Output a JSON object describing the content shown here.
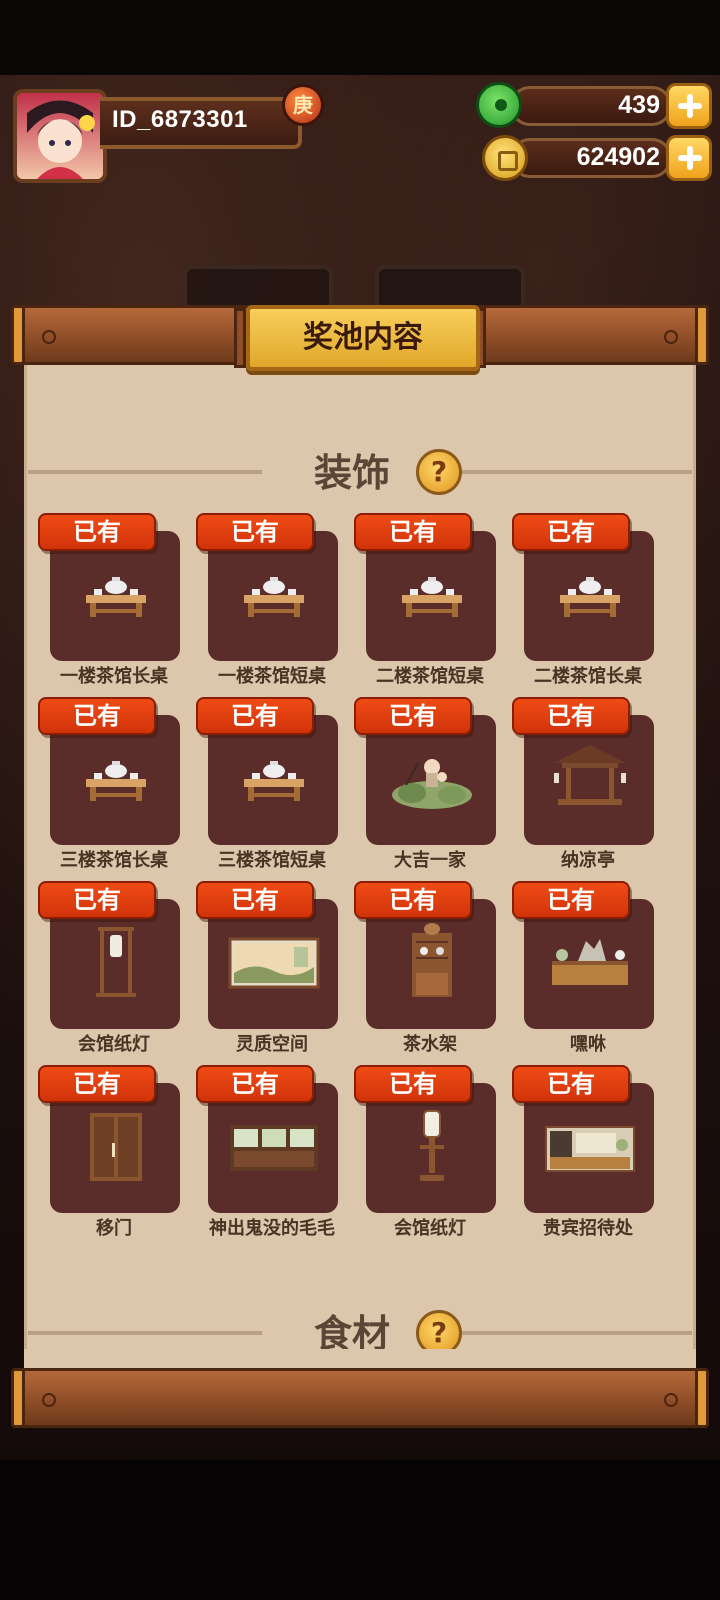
{
  "header": {
    "user_id": "ID_6873301",
    "badge_text": "庚",
    "jade_value": "439",
    "coin_value": "624902"
  },
  "panel": {
    "title": "奖池内容",
    "sections": [
      {
        "title": "装饰",
        "items": [
          {
            "status": "已有",
            "name": "一楼茶馆长桌",
            "icon": "tea-table-icon"
          },
          {
            "status": "已有",
            "name": "一楼茶馆短桌",
            "icon": "tea-table-icon"
          },
          {
            "status": "已有",
            "name": "二楼茶馆短桌",
            "icon": "tea-table-icon"
          },
          {
            "status": "已有",
            "name": "二楼茶馆长桌",
            "icon": "tea-table-icon"
          },
          {
            "status": "已有",
            "name": "三楼茶馆长桌",
            "icon": "tea-table-icon"
          },
          {
            "status": "已有",
            "name": "三楼茶馆短桌",
            "icon": "tea-table-icon"
          },
          {
            "status": "已有",
            "name": "大吉一家",
            "icon": "family-rock-icon"
          },
          {
            "status": "已有",
            "name": "纳凉亭",
            "icon": "pavilion-icon"
          },
          {
            "status": "已有",
            "name": "会馆纸灯",
            "icon": "paper-lantern-stand-icon"
          },
          {
            "status": "已有",
            "name": "灵质空间",
            "icon": "landscape-screen-icon"
          },
          {
            "status": "已有",
            "name": "茶水架",
            "icon": "tea-shelf-icon"
          },
          {
            "status": "已有",
            "name": "嘿咻",
            "icon": "rock-garden-cabinet-icon"
          },
          {
            "status": "已有",
            "name": "移门",
            "icon": "sliding-door-icon"
          },
          {
            "status": "已有",
            "name": "神出鬼没的毛毛",
            "icon": "window-panel-icon"
          },
          {
            "status": "已有",
            "name": "会馆纸灯",
            "icon": "paper-lamp-icon"
          },
          {
            "status": "已有",
            "name": "贵宾招待处",
            "icon": "reception-desk-icon"
          }
        ]
      },
      {
        "title": "食材",
        "items": []
      }
    ]
  }
}
